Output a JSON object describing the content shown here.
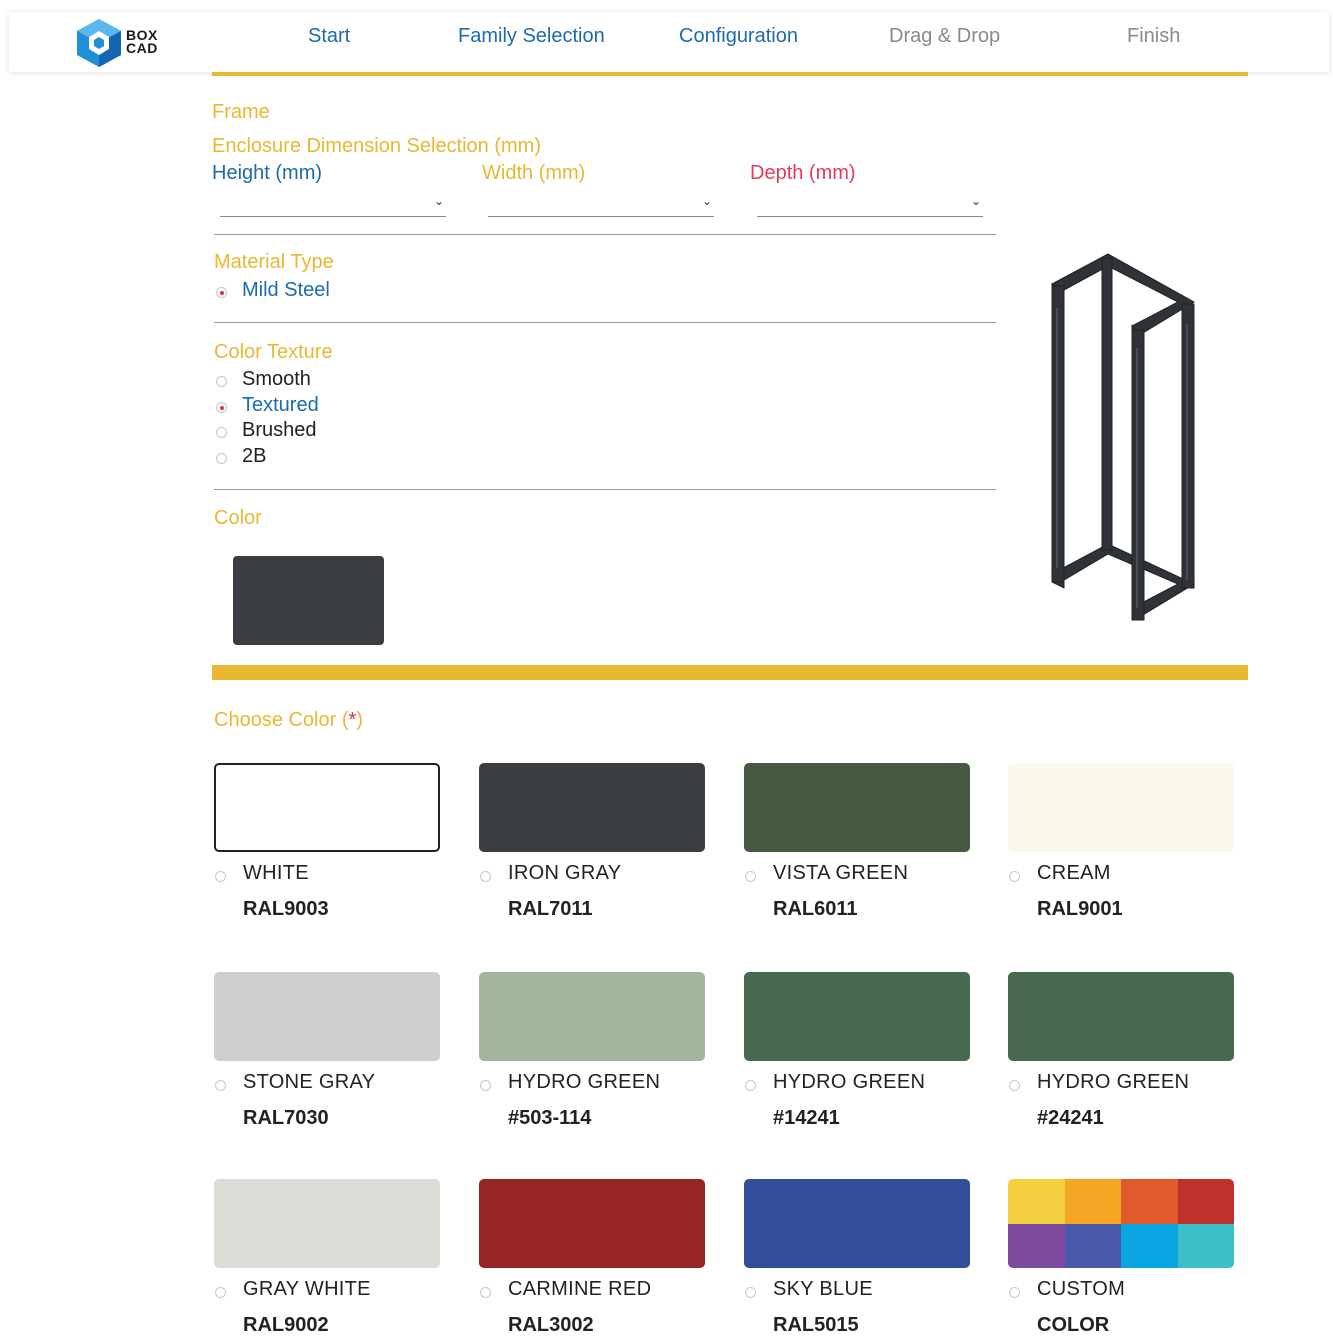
{
  "brand": {
    "line1": "BOX",
    "line2": "CAD"
  },
  "nav": [
    {
      "label": "Start",
      "active": true
    },
    {
      "label": "Family Selection",
      "active": true
    },
    {
      "label": "Configuration",
      "active": true
    },
    {
      "label": "Drag & Drop",
      "active": false
    },
    {
      "label": "Finish",
      "active": false
    }
  ],
  "frame": {
    "section_title": "Frame",
    "dimension_title": "Enclosure Dimension Selection (mm)",
    "height_label": "Height (mm)",
    "width_label": "Width (mm)",
    "depth_label": "Depth (mm)"
  },
  "material": {
    "title": "Material Type",
    "options": [
      {
        "label": "Mild Steel",
        "checked": true
      }
    ]
  },
  "texture": {
    "title": "Color Texture",
    "options": [
      {
        "label": "Smooth",
        "checked": false
      },
      {
        "label": "Textured",
        "checked": true
      },
      {
        "label": "Brushed",
        "checked": false
      },
      {
        "label": "2B",
        "checked": false
      }
    ]
  },
  "color": {
    "title": "Color",
    "current": "#3a3d42"
  },
  "choose": {
    "title": "Choose Color (",
    "required": "*",
    "title_end": ")"
  },
  "swatches": [
    {
      "name": "WHITE",
      "code": "RAL9003",
      "color": "#ffffff",
      "selected": true
    },
    {
      "name": "IRON GRAY",
      "code": "RAL7011",
      "color": "#3a3d42"
    },
    {
      "name": "VISTA GREEN",
      "code": "RAL6011",
      "color": "#465a42"
    },
    {
      "name": "CREAM",
      "code": "RAL9001",
      "color": "#fdf8ec"
    },
    {
      "name": "STONE GRAY",
      "code": "RAL7030",
      "color": "#cfcdce"
    },
    {
      "name": "HYDRO GREEN",
      "code": "#503-114",
      "color": "#a5b59c"
    },
    {
      "name": "HYDRO GREEN",
      "code": "#14241",
      "color": "#47694e"
    },
    {
      "name": "HYDRO GREEN",
      "code": "#24241",
      "color": "#47694e"
    },
    {
      "name": "GRAY WHITE",
      "code": "RAL9002",
      "color": "#dcdcd6"
    },
    {
      "name": "CARMINE RED",
      "code": "RAL3002",
      "color": "#952623"
    },
    {
      "name": "SKY BLUE",
      "code": "RAL5015",
      "color": "#324e98"
    },
    {
      "name": "CUSTOM",
      "code": "COLOR",
      "custom": true,
      "palette": [
        "#f5d142",
        "#f5a623",
        "#e05a2b",
        "#c0312b",
        "#7d4a9e",
        "#4a5aa8",
        "#0aa5e0",
        "#3cc0c8"
      ]
    }
  ]
}
